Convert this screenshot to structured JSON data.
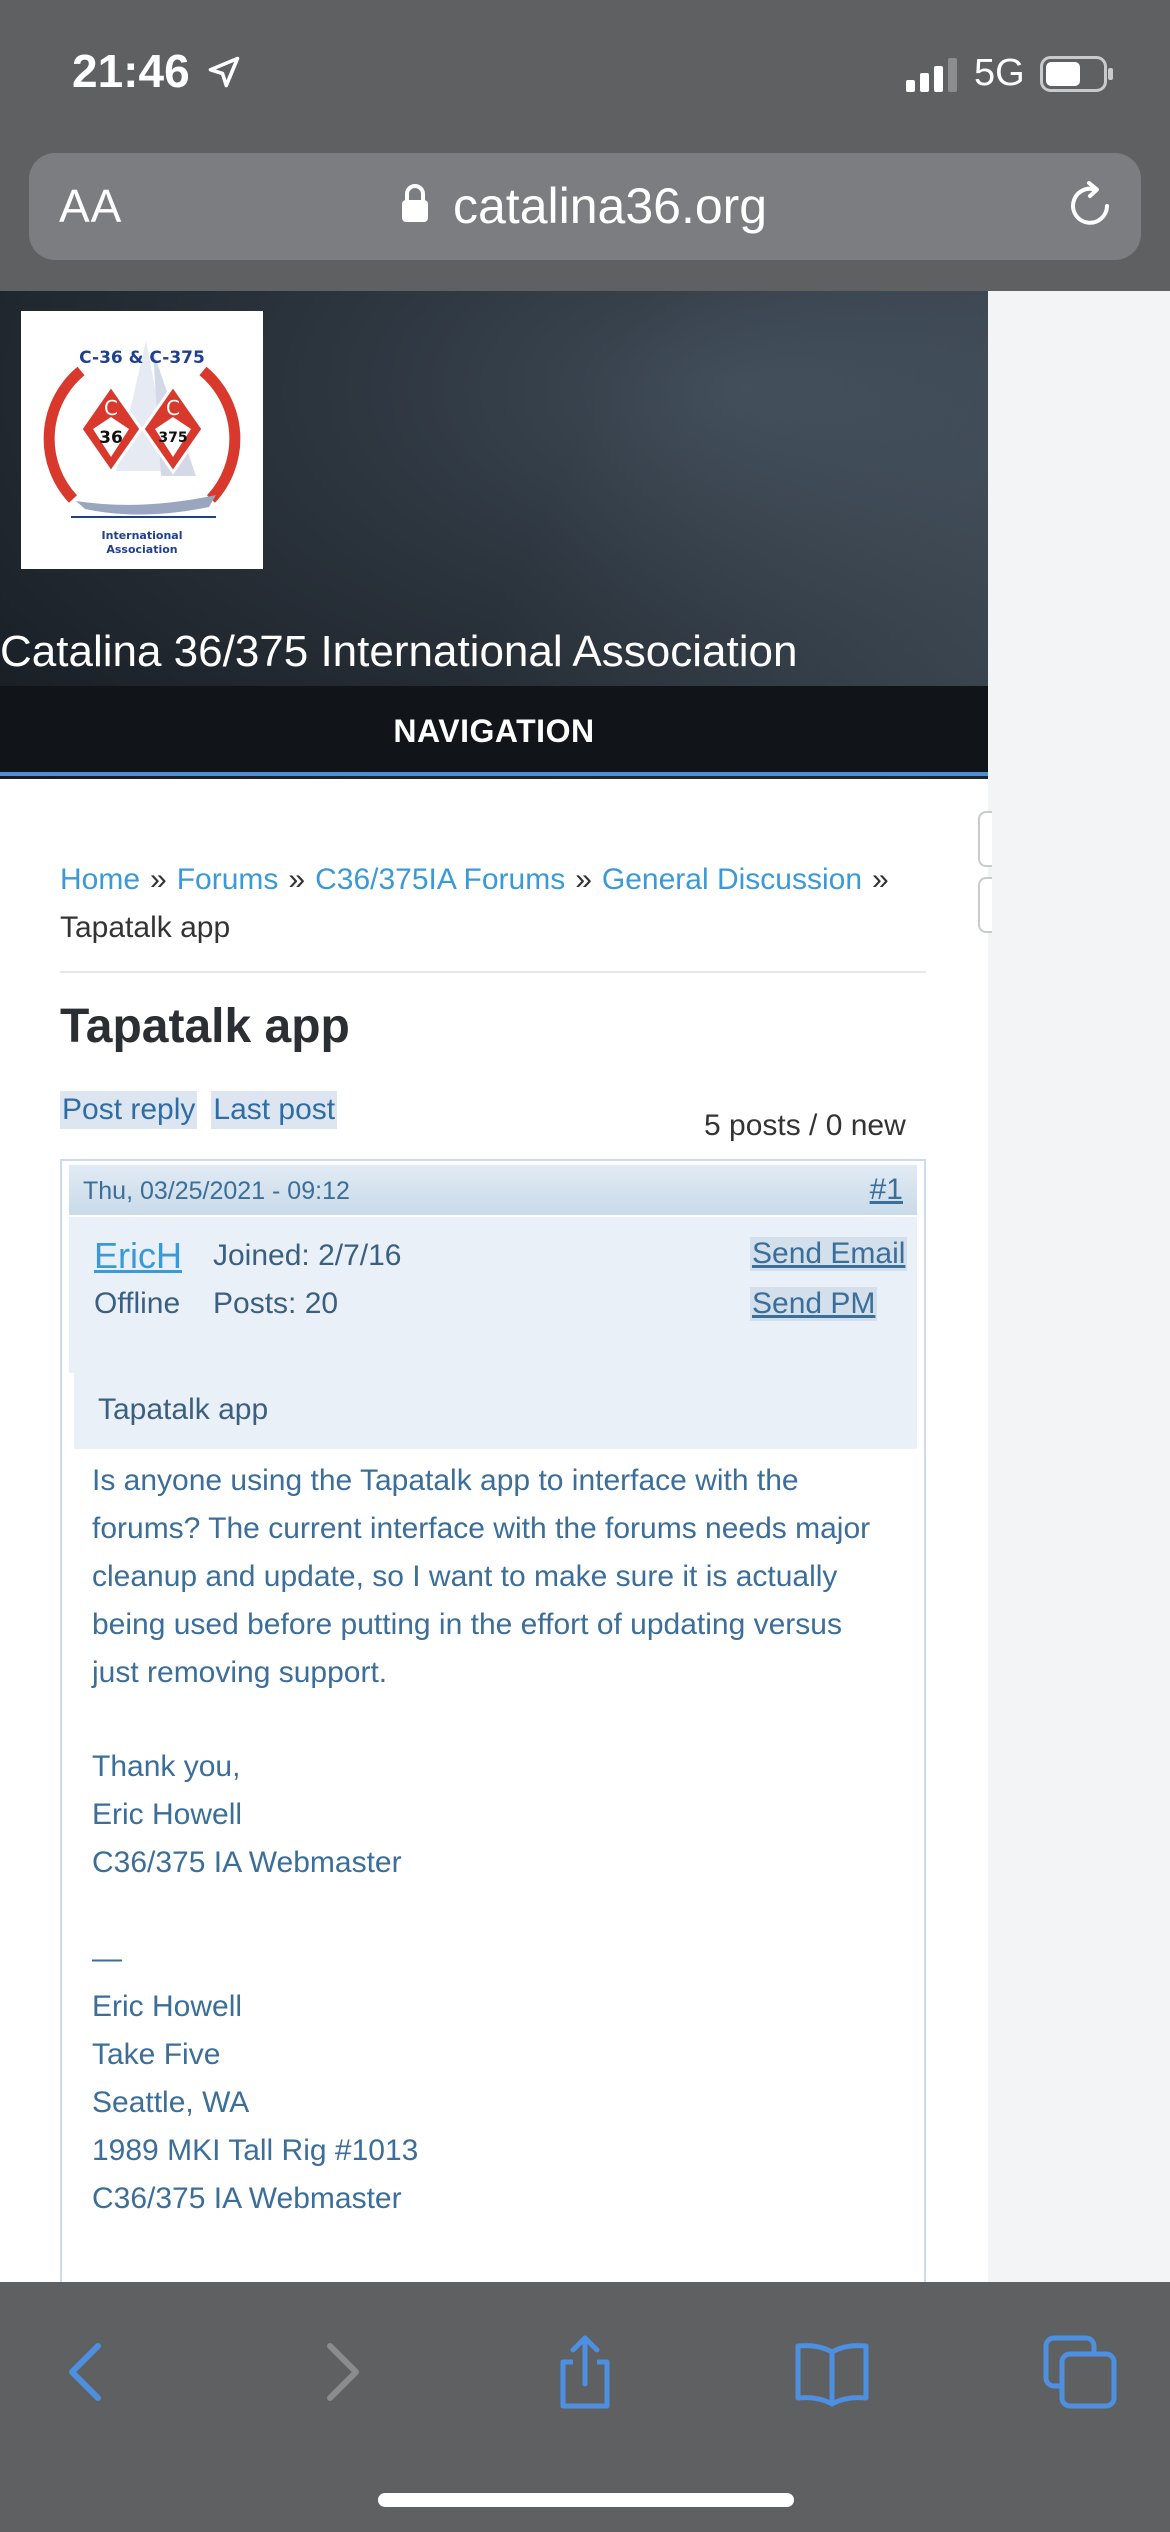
{
  "status_bar": {
    "time": "21:46",
    "network": "5G"
  },
  "url_bar": {
    "text_size_label": "AA",
    "domain": "catalina36.org"
  },
  "header": {
    "site_name": "Catalina 36/375 International Association",
    "navigation_label": "NAVIGATION",
    "logo": {
      "top_text": "C-36 & C-375",
      "left_diamond": "C",
      "left_num": "36",
      "right_diamond": "C",
      "right_num": "375",
      "bottom_text_1": "International",
      "bottom_text_2": "Association"
    }
  },
  "breadcrumb": {
    "items": [
      "Home",
      "Forums",
      "C36/375IA Forums",
      "General Discussion"
    ],
    "separator": "»",
    "current": "Tapatalk app"
  },
  "topic": {
    "title": "Tapatalk app",
    "post_reply_label": "Post reply",
    "last_post_label": "Last post",
    "count_text": "5 posts / 0 new"
  },
  "post": {
    "date": "Thu, 03/25/2021 - 09:12",
    "number": "#1",
    "username": "EricH",
    "joined": "Joined: 2/7/16",
    "status": "Offline",
    "posts": "Posts: 20",
    "send_email_label": "Send Email",
    "send_pm_label": "Send PM",
    "subject": "Tapatalk app",
    "body_paragraph": "Is anyone using the Tapatalk app to interface with the forums? The current interface with the forums needs major cleanup and update, so I want to make sure it is actually being used before putting in the effort of updating versus just removing support.",
    "closing": [
      "Thank you,",
      "Eric Howell",
      "C36/375 IA Webmaster"
    ],
    "signature_divider": "—",
    "signature": [
      "Eric Howell",
      "Take Five",
      "Seattle, WA",
      "1989 MKI Tall Rig #1013",
      "C36/375 IA Webmaster"
    ]
  },
  "toolbar": {
    "icons": [
      "back-icon",
      "forward-icon",
      "share-icon",
      "bookmarks-icon",
      "tabs-icon"
    ]
  },
  "colors": {
    "link": "#3a9ad9",
    "post_text": "#3b6e99",
    "nav_accent": "#4d8fd6",
    "toolbar_bg": "#5f6062"
  }
}
